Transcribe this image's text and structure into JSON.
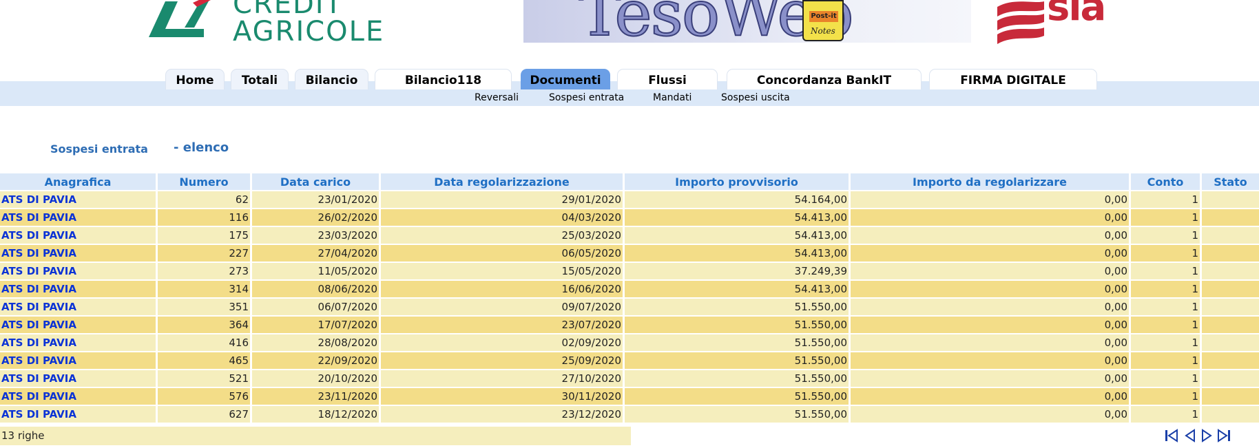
{
  "header": {
    "left_logo_lines": [
      "CREDIT",
      "AGRICOLE"
    ],
    "center_logo_text": "TesoWeb",
    "postit_brand": "Post-it",
    "postit_sub": "Notes",
    "right_logo_text": "sia"
  },
  "nav": {
    "tabs": [
      {
        "label": "Home"
      },
      {
        "label": "Totali"
      },
      {
        "label": "Bilancio"
      },
      {
        "label": "Bilancio118"
      },
      {
        "label": "Documenti",
        "active": true
      },
      {
        "label": "Flussi"
      },
      {
        "label": "Concordanza BankIT"
      },
      {
        "label": "FIRMA DIGITALE"
      }
    ],
    "subtabs": [
      {
        "label": "Reversali"
      },
      {
        "label": "Sospesi entrata"
      },
      {
        "label": "Mandati"
      },
      {
        "label": "Sospesi uscita"
      }
    ]
  },
  "page": {
    "title": "Sospesi entrata",
    "subtitle": "- elenco"
  },
  "table": {
    "columns": [
      "Anagrafica",
      "Numero",
      "Data carico",
      "Data regolarizzazione",
      "Importo provvisorio",
      "Importo da regolarizzare",
      "Conto",
      "Stato"
    ],
    "rows": [
      [
        "ATS DI PAVIA",
        "62",
        "23/01/2020",
        "29/01/2020",
        "54.164,00",
        "0,00",
        "1",
        ""
      ],
      [
        "ATS DI PAVIA",
        "116",
        "26/02/2020",
        "04/03/2020",
        "54.413,00",
        "0,00",
        "1",
        ""
      ],
      [
        "ATS DI PAVIA",
        "175",
        "23/03/2020",
        "25/03/2020",
        "54.413,00",
        "0,00",
        "1",
        ""
      ],
      [
        "ATS DI PAVIA",
        "227",
        "27/04/2020",
        "06/05/2020",
        "54.413,00",
        "0,00",
        "1",
        ""
      ],
      [
        "ATS DI PAVIA",
        "273",
        "11/05/2020",
        "15/05/2020",
        "37.249,39",
        "0,00",
        "1",
        ""
      ],
      [
        "ATS DI PAVIA",
        "314",
        "08/06/2020",
        "16/06/2020",
        "54.413,00",
        "0,00",
        "1",
        ""
      ],
      [
        "ATS DI PAVIA",
        "351",
        "06/07/2020",
        "09/07/2020",
        "51.550,00",
        "0,00",
        "1",
        ""
      ],
      [
        "ATS DI PAVIA",
        "364",
        "17/07/2020",
        "23/07/2020",
        "51.550,00",
        "0,00",
        "1",
        ""
      ],
      [
        "ATS DI PAVIA",
        "416",
        "28/08/2020",
        "02/09/2020",
        "51.550,00",
        "0,00",
        "1",
        ""
      ],
      [
        "ATS DI PAVIA",
        "465",
        "22/09/2020",
        "25/09/2020",
        "51.550,00",
        "0,00",
        "1",
        ""
      ],
      [
        "ATS DI PAVIA",
        "521",
        "20/10/2020",
        "27/10/2020",
        "51.550,00",
        "0,00",
        "1",
        ""
      ],
      [
        "ATS DI PAVIA",
        "576",
        "23/11/2020",
        "30/11/2020",
        "51.550,00",
        "0,00",
        "1",
        ""
      ],
      [
        "ATS DI PAVIA",
        "627",
        "18/12/2020",
        "23/12/2020",
        "51.550,00",
        "0,00",
        "1",
        ""
      ]
    ],
    "footer": "13 righe"
  },
  "pager": {
    "icons": [
      "first-page-icon",
      "prev-page-icon",
      "next-page-icon",
      "last-page-icon"
    ]
  },
  "colors": {
    "nav_band": "#dbe8f8",
    "active_tab": "#6b9fe6",
    "row_light": "#f5eebd",
    "row_dark": "#f3dd88",
    "header_text": "#1f6fc4",
    "link_text": "#0b33d6",
    "ca_green": "#1a8a6e",
    "sia_red": "#c82a3a"
  }
}
